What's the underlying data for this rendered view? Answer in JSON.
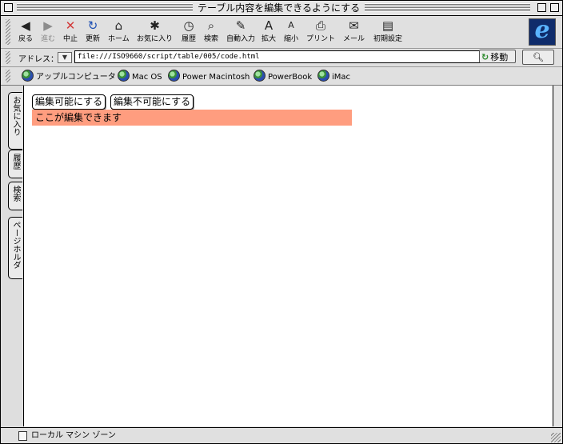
{
  "window": {
    "title": "テーブル内容を編集できるようにする"
  },
  "toolbar": {
    "items": [
      {
        "label": "戻る",
        "icon": "back-arrow-icon",
        "glyph": "◀",
        "enabled": true
      },
      {
        "label": "進む",
        "icon": "forward-arrow-icon",
        "glyph": "▶",
        "enabled": false
      },
      {
        "label": "中止",
        "icon": "stop-icon",
        "glyph": "✕",
        "enabled": true
      },
      {
        "label": "更新",
        "icon": "refresh-icon",
        "glyph": "↻",
        "enabled": true
      },
      {
        "label": "ホーム",
        "icon": "home-icon",
        "glyph": "⌂",
        "enabled": true
      },
      {
        "label": "お気に入り",
        "icon": "favorites-icon",
        "glyph": "✱",
        "enabled": true
      },
      {
        "label": "履歴",
        "icon": "history-icon",
        "glyph": "◷",
        "enabled": true
      },
      {
        "label": "検索",
        "icon": "search-icon",
        "glyph": "⌕",
        "enabled": true
      },
      {
        "label": "自動入力",
        "icon": "autofill-icon",
        "glyph": "✎",
        "enabled": true
      },
      {
        "label": "拡大",
        "icon": "larger-text-icon",
        "glyph": "A",
        "enabled": true
      },
      {
        "label": "縮小",
        "icon": "smaller-text-icon",
        "glyph": "A",
        "enabled": true
      },
      {
        "label": "プリント",
        "icon": "print-icon",
        "glyph": "⎙",
        "enabled": true
      },
      {
        "label": "メール",
        "icon": "mail-icon",
        "glyph": "✉",
        "enabled": true
      },
      {
        "label": "初期設定",
        "icon": "preferences-icon",
        "glyph": "▤",
        "enabled": true
      }
    ]
  },
  "address": {
    "label": "アドレス：",
    "url": "file:///ISO9660/script/table/005/code.html",
    "go_label": "移動"
  },
  "favorites": [
    {
      "label": "アップルコンピュータ"
    },
    {
      "label": "Mac OS"
    },
    {
      "label": "Power Macintosh"
    },
    {
      "label": "PowerBook"
    },
    {
      "label": "iMac"
    }
  ],
  "side_tabs": [
    {
      "label": "お気に入り"
    },
    {
      "label": "履歴"
    },
    {
      "label": "検索"
    },
    {
      "label": "ページホルダ"
    }
  ],
  "page": {
    "editable_button": "編集可能にする",
    "non_editable_button": "編集不可能にする",
    "edit_area_text": "ここが編集できます",
    "edit_area_color": "#ff9d7f"
  },
  "status": {
    "zone": "ローカル マシン ゾーン"
  }
}
